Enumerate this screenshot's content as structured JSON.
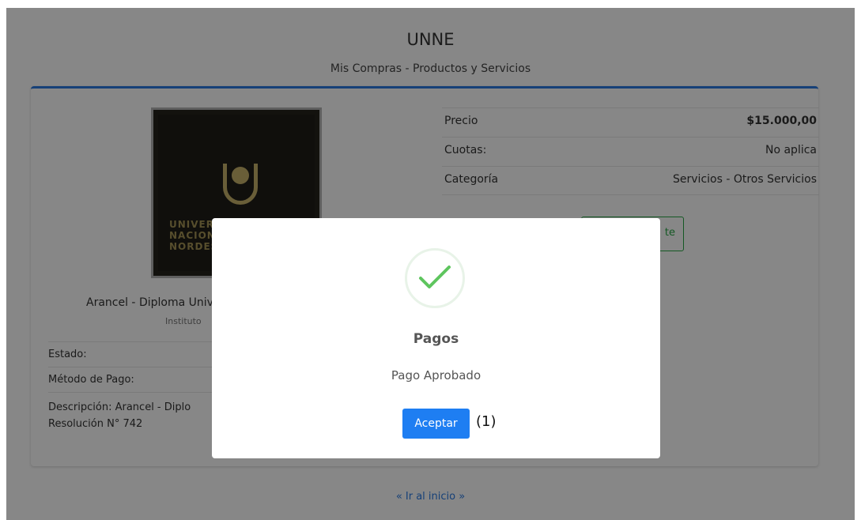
{
  "header": {
    "title": "UNNE",
    "subtitle": "Mis Compras - Productos y Servicios"
  },
  "product": {
    "image_text": "UNIVERSIDAD NACIONAL DEL NORDESTE",
    "name": "Arancel - Diploma Universitario",
    "institution": "Instituto"
  },
  "details": {
    "estado_label": "Estado:",
    "metodo_label": "Método de Pago:",
    "descripcion": "Descripción: Arancel - Diplo",
    "resolucion": "Resolución N° 742"
  },
  "pricing": {
    "rows": [
      {
        "label": "Precio",
        "value": "$15.000,00"
      },
      {
        "label": "Cuotas:",
        "value": "No aplica"
      },
      {
        "label": "Categoría",
        "value": "Servicios - Otros Servicios"
      }
    ],
    "button_label": "te"
  },
  "footer": {
    "home_link": "« Ir al inicio »"
  },
  "modal": {
    "title": "Pagos",
    "message": "Pago Aprobado",
    "accept_label": "Aceptar",
    "marker": "(1)",
    "icon": "check-icon",
    "icon_color": "#5ec55e"
  },
  "colors": {
    "accent": "#2a7ae2",
    "button": "#1e7ef2",
    "success": "#28a745"
  }
}
